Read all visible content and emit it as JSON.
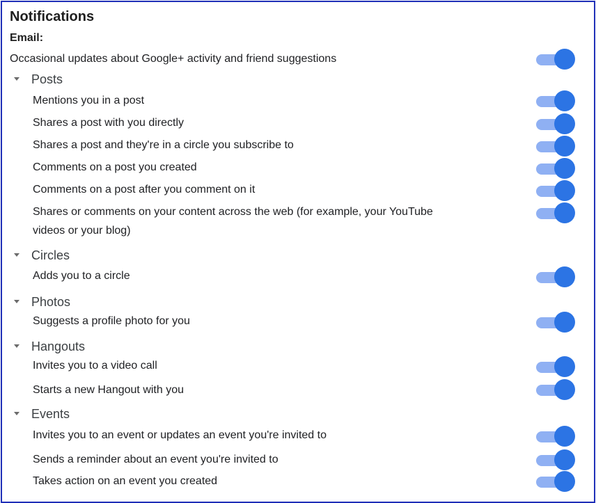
{
  "title": "Notifications",
  "email_label": "Email:",
  "general": {
    "text": "Occasional updates about Google+ activity and friend suggestions",
    "on": true
  },
  "sections": [
    {
      "label": "Posts",
      "items": [
        {
          "text": "Mentions you in a post",
          "on": true
        },
        {
          "text": "Shares a post with you directly",
          "on": true
        },
        {
          "text": "Shares a post and they're in a circle you subscribe to",
          "on": true
        },
        {
          "text": "Comments on a post you created",
          "on": true
        },
        {
          "text": "Comments on a post after you comment on it",
          "on": true
        },
        {
          "text": "Shares or comments on your content across the web (for example, your YouTube",
          "text2": "videos or your blog)",
          "on": true
        }
      ]
    },
    {
      "label": "Circles",
      "items": [
        {
          "text": "Adds you to a circle",
          "on": true
        }
      ]
    },
    {
      "label": "Photos",
      "items": [
        {
          "text": "Suggests a profile photo for you",
          "on": true
        }
      ]
    },
    {
      "label": "Hangouts",
      "items": [
        {
          "text": "Invites you to a video call",
          "on": true
        },
        {
          "text": "Starts a new Hangout with you",
          "on": true
        }
      ]
    },
    {
      "label": "Events",
      "items": [
        {
          "text": "Invites you to an event or updates an event you're invited to",
          "on": true
        },
        {
          "text": "Sends a reminder about an event you're invited to",
          "on": true
        },
        {
          "text": "Takes action on an event you created",
          "on": true
        }
      ]
    }
  ],
  "colors": {
    "toggle_track_on": "#8fb0f3",
    "toggle_thumb_on": "#2c74e4",
    "frame_border": "#1f2fb8"
  },
  "icons": {
    "section_caret": "caret-down-icon"
  }
}
